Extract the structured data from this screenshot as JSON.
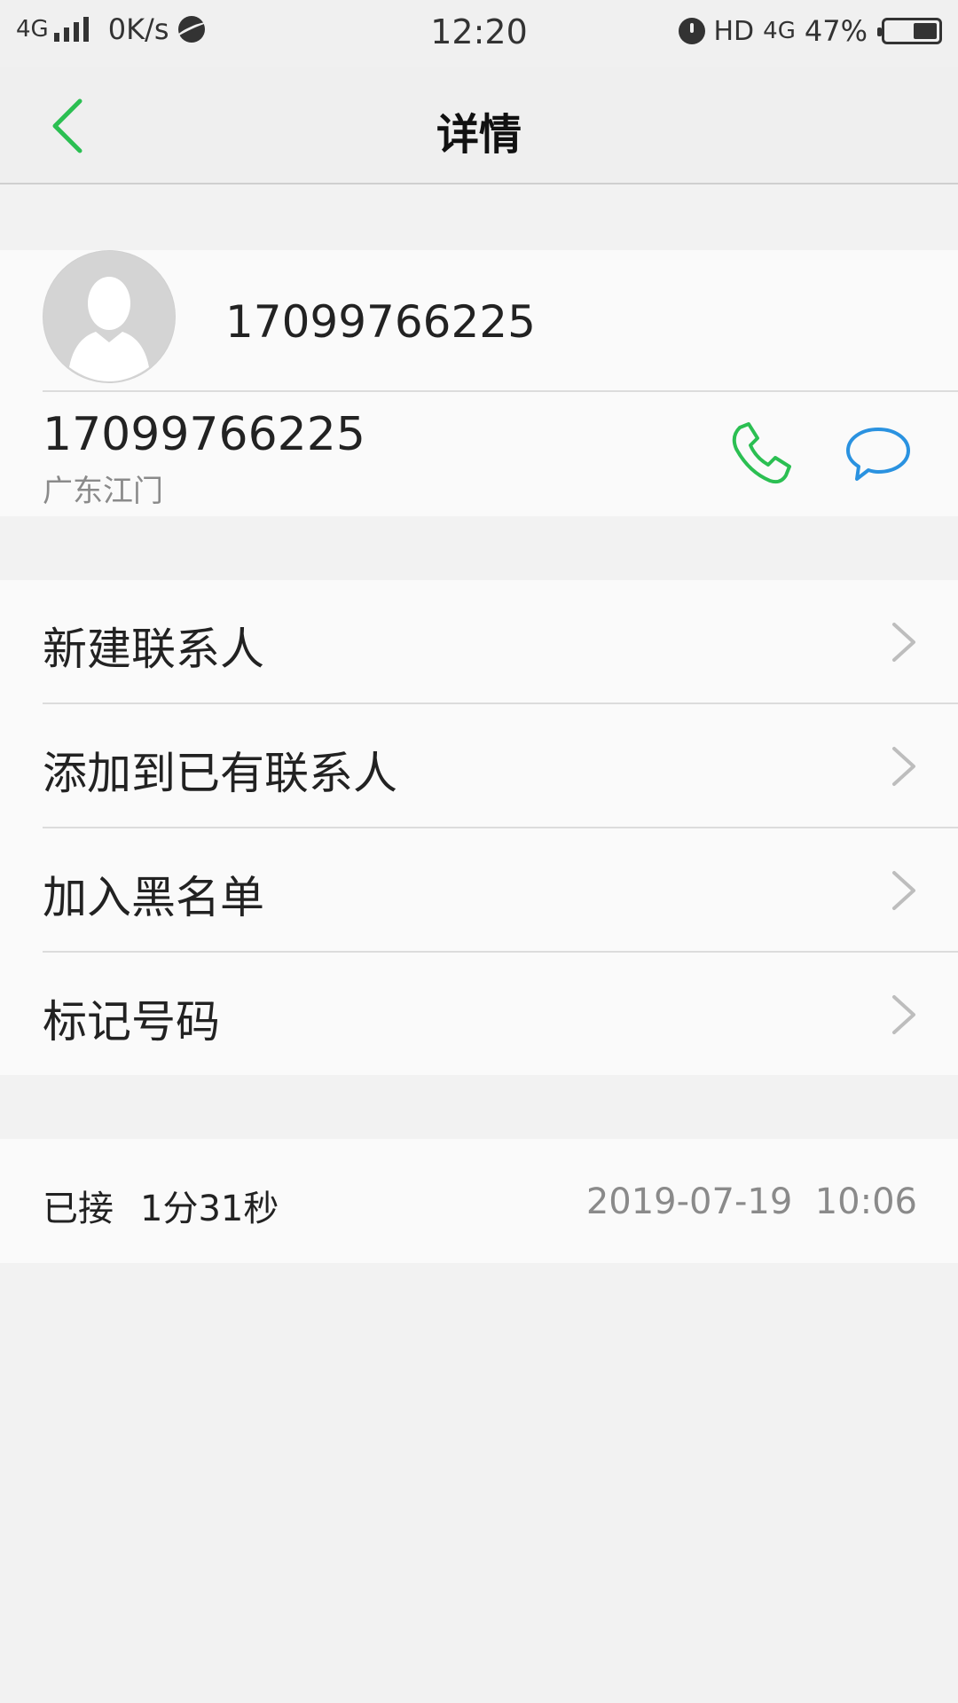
{
  "status_bar": {
    "network": "4G",
    "speed": "0K/s",
    "time": "12:20",
    "hd": "HD",
    "network_right": "4G",
    "battery": "47%",
    "battery_level": 0.47
  },
  "nav": {
    "title": "详情"
  },
  "contact": {
    "header_number": "17099766225",
    "number": "17099766225",
    "location": "广东江门"
  },
  "actions": [
    {
      "label": "新建联系人"
    },
    {
      "label": "添加到已有联系人"
    },
    {
      "label": "加入黑名单"
    },
    {
      "label": "标记号码"
    }
  ],
  "call_log": {
    "type": "已接",
    "duration": "1分31秒",
    "datetime": "2019-07-19  10:06"
  },
  "colors": {
    "accent_green": "#2bbf52",
    "accent_blue": "#2a92e0",
    "background": "#f2f2f2",
    "card": "#fafafa"
  }
}
